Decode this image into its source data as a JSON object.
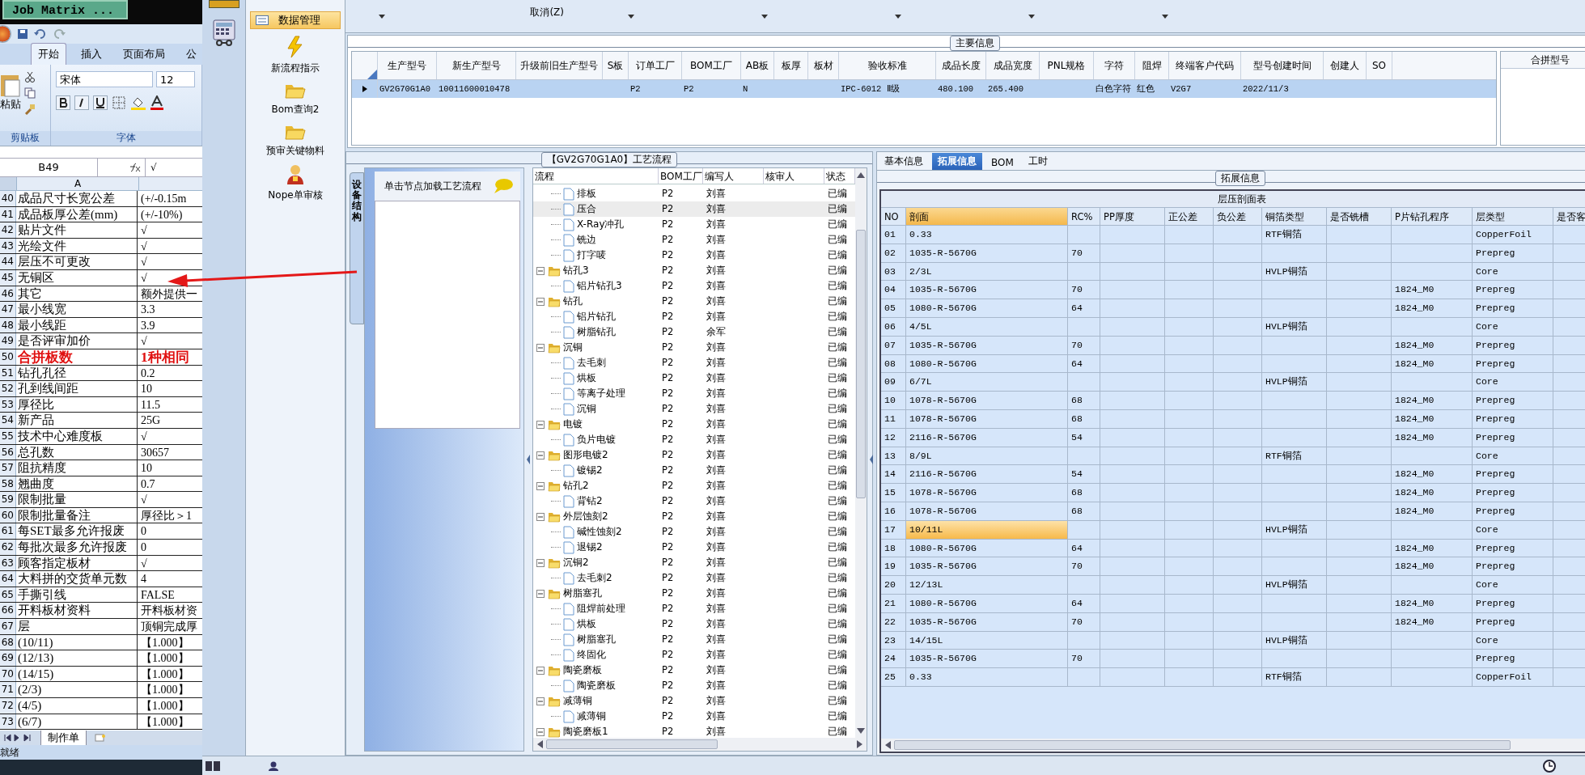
{
  "excel": {
    "title": "Job Matrix ...",
    "ribbon_tabs": [
      {
        "label": "开始",
        "selected": true
      },
      {
        "label": "插入",
        "selected": false
      },
      {
        "label": "页面布局",
        "selected": false
      },
      {
        "label": "公",
        "selected": false
      }
    ],
    "paste_label": "粘贴",
    "clipboard_group": "剪贴板",
    "font_name": "宋体",
    "font_size": "12",
    "font_group": "字体",
    "name_box": "B49",
    "formula": "√",
    "column_header": "A",
    "rows": [
      {
        "num": "40",
        "a": "成品尺寸长宽公差",
        "b": "(+/-0.15m",
        "emphasis": false
      },
      {
        "num": "41",
        "a": "成品板厚公差(mm)",
        "b": "(+/-10%)",
        "emphasis": false
      },
      {
        "num": "42",
        "a": "贴片文件",
        "b": "√",
        "emphasis": false
      },
      {
        "num": "43",
        "a": "光绘文件",
        "b": "√",
        "emphasis": false
      },
      {
        "num": "44",
        "a": "层压不可更改",
        "b": "√",
        "emphasis": false
      },
      {
        "num": "45",
        "a": "无铜区",
        "b": "√",
        "emphasis": false
      },
      {
        "num": "46",
        "a": "其它",
        "b": "额外提供一",
        "emphasis": false
      },
      {
        "num": "47",
        "a": "最小线宽",
        "b": "3.3",
        "emphasis": false
      },
      {
        "num": "48",
        "a": "最小线距",
        "b": "3.9",
        "emphasis": false
      },
      {
        "num": "49",
        "a": "是否评审加价",
        "b": "√",
        "emphasis": false
      },
      {
        "num": "50",
        "a": "合拼板数",
        "b": "1种相同",
        "emphasis": true
      },
      {
        "num": "51",
        "a": "钻孔孔径",
        "b": "0.2",
        "emphasis": false
      },
      {
        "num": "52",
        "a": "孔到线间距",
        "b": "10",
        "emphasis": false
      },
      {
        "num": "53",
        "a": "厚径比",
        "b": "11.5",
        "emphasis": false
      },
      {
        "num": "54",
        "a": "新产品",
        "b": "25G",
        "emphasis": false
      },
      {
        "num": "55",
        "a": "技术中心难度板",
        "b": "√",
        "emphasis": false
      },
      {
        "num": "56",
        "a": "总孔数",
        "b": "30657",
        "emphasis": false
      },
      {
        "num": "57",
        "a": "阻抗精度",
        "b": "10",
        "emphasis": false
      },
      {
        "num": "58",
        "a": "翘曲度",
        "b": "0.7",
        "emphasis": false
      },
      {
        "num": "59",
        "a": "限制批量",
        "b": "√",
        "emphasis": false
      },
      {
        "num": "60",
        "a": "限制批量备注",
        "b": "厚径比＞1",
        "emphasis": false
      },
      {
        "num": "61",
        "a": "每SET最多允许报废",
        "b": "0",
        "emphasis": false
      },
      {
        "num": "62",
        "a": "每批次最多允许报废",
        "b": "0",
        "emphasis": false
      },
      {
        "num": "63",
        "a": "顾客指定板材",
        "b": "√",
        "emphasis": false
      },
      {
        "num": "64",
        "a": "大料拼的交货单元数",
        "b": "4",
        "emphasis": false
      },
      {
        "num": "65",
        "a": "手撕引线",
        "b": "FALSE",
        "emphasis": false
      },
      {
        "num": "66",
        "a": "开料板材资料",
        "b": "开料板材资",
        "emphasis": false
      },
      {
        "num": "67",
        "a": "层",
        "b": "顶铜完成厚",
        "emphasis": false
      },
      {
        "num": "68",
        "a": "(10/11)",
        "b": "【1.000】",
        "emphasis": false
      },
      {
        "num": "69",
        "a": "(12/13)",
        "b": "【1.000】",
        "emphasis": false
      },
      {
        "num": "70",
        "a": "(14/15)",
        "b": "【1.000】",
        "emphasis": false
      },
      {
        "num": "71",
        "a": "(2/3)",
        "b": "【1.000】",
        "emphasis": false
      },
      {
        "num": "72",
        "a": "(4/5)",
        "b": "【1.000】",
        "emphasis": false
      },
      {
        "num": "73",
        "a": "(6/7)",
        "b": "【1.000】",
        "emphasis": false
      }
    ],
    "sheet_tab": "制作单",
    "status": "就绪"
  },
  "nav": {
    "items": [
      {
        "label": "数据管理",
        "selected": true
      }
    ],
    "tools": [
      {
        "kind": "bolt",
        "label": "新流程指示"
      },
      {
        "kind": "folder",
        "label": "Bom查询2"
      },
      {
        "kind": "folder",
        "label": "预审关键物料"
      },
      {
        "kind": "person",
        "label": "Nope单审核"
      }
    ]
  },
  "toolbar": {
    "label": "取消(Z)"
  },
  "main_info": {
    "title": "主要信息",
    "columns": [
      "生产型号",
      "新生产型号",
      "升级前旧生产型号",
      "S板",
      "订单工厂",
      "BOM工厂",
      "AB板",
      "板厚",
      "板材",
      "验收标准",
      "成品长度",
      "成品宽度",
      "PNL规格",
      "字符",
      "阻焊",
      "终端客户代码",
      "型号创建时间",
      "创建人",
      "SO"
    ],
    "rows": [
      {
        "selected": true,
        "cells": [
          "GV2G70G1A0",
          "10011600010478",
          "",
          "",
          "P2",
          "P2",
          "N",
          "",
          "",
          "IPC-6012 Ⅱ级",
          "480.100",
          "265.400",
          "",
          "白色字符",
          "红色",
          "V2G7",
          "2022/11/3",
          "",
          ""
        ]
      }
    ],
    "merge_title": "合拼型号"
  },
  "flow": {
    "title": "【GV2G70G1A0】工艺流程",
    "side_tab": "设备结构",
    "hint": "单击节点加载工艺流程",
    "columns": [
      "流程",
      "BOM工厂",
      "编写人",
      "核审人",
      "状态"
    ],
    "nodes": [
      {
        "children": [
          {
            "label": "排板",
            "bom": "P2",
            "writer": "刘喜",
            "status": "已编",
            "selected": false
          },
          {
            "label": "压合",
            "bom": "P2",
            "writer": "刘喜",
            "status": "已编",
            "selected": true
          },
          {
            "label": "X-Ray冲孔",
            "bom": "P2",
            "writer": "刘喜",
            "status": "已编",
            "selected": false
          },
          {
            "label": "铣边",
            "bom": "P2",
            "writer": "刘喜",
            "status": "已编",
            "selected": false
          },
          {
            "label": "打字唛",
            "bom": "P2",
            "writer": "刘喜",
            "status": "已编",
            "selected": false
          }
        ]
      },
      {
        "label": "钻孔3",
        "bom": "P2",
        "writer": "刘喜",
        "status": "已编",
        "selected": false,
        "expanded": true,
        "children": [
          {
            "label": "铝片钻孔3",
            "bom": "P2",
            "writer": "刘喜",
            "status": "已编",
            "selected": false
          }
        ]
      },
      {
        "label": "钻孔",
        "bom": "P2",
        "writer": "刘喜",
        "status": "已编",
        "selected": false,
        "expanded": true,
        "children": [
          {
            "label": "铝片钻孔",
            "bom": "P2",
            "writer": "刘喜",
            "status": "已编",
            "selected": false
          },
          {
            "label": "树脂钻孔",
            "bom": "P2",
            "writer": "余军",
            "status": "已编",
            "selected": false
          }
        ]
      },
      {
        "label": "沉铜",
        "bom": "P2",
        "writer": "刘喜",
        "status": "已编",
        "selected": false,
        "expanded": true,
        "children": [
          {
            "label": "去毛刺",
            "bom": "P2",
            "writer": "刘喜",
            "status": "已编",
            "selected": false
          },
          {
            "label": "烘板",
            "bom": "P2",
            "writer": "刘喜",
            "status": "已编",
            "selected": false
          },
          {
            "label": "等离子处理",
            "bom": "P2",
            "writer": "刘喜",
            "status": "已编",
            "selected": false
          },
          {
            "label": "沉铜",
            "bom": "P2",
            "writer": "刘喜",
            "status": "已编",
            "selected": false
          }
        ]
      },
      {
        "label": "电镀",
        "bom": "P2",
        "writer": "刘喜",
        "status": "已编",
        "selected": false,
        "expanded": true,
        "children": [
          {
            "label": "负片电镀",
            "bom": "P2",
            "writer": "刘喜",
            "status": "已编",
            "selected": false
          }
        ]
      },
      {
        "label": "图形电镀2",
        "bom": "P2",
        "writer": "刘喜",
        "status": "已编",
        "selected": false,
        "expanded": true,
        "children": [
          {
            "label": "镀锡2",
            "bom": "P2",
            "writer": "刘喜",
            "status": "已编",
            "selected": false
          }
        ]
      },
      {
        "label": "钻孔2",
        "bom": "P2",
        "writer": "刘喜",
        "status": "已编",
        "selected": false,
        "expanded": true,
        "children": [
          {
            "label": "背钻2",
            "bom": "P2",
            "writer": "刘喜",
            "status": "已编",
            "selected": false
          }
        ]
      },
      {
        "label": "外层蚀刻2",
        "bom": "P2",
        "writer": "刘喜",
        "status": "已编",
        "selected": false,
        "expanded": true,
        "children": [
          {
            "label": "碱性蚀刻2",
            "bom": "P2",
            "writer": "刘喜",
            "status": "已编",
            "selected": false
          },
          {
            "label": "退锡2",
            "bom": "P2",
            "writer": "刘喜",
            "status": "已编",
            "selected": false
          }
        ]
      },
      {
        "label": "沉铜2",
        "bom": "P2",
        "writer": "刘喜",
        "status": "已编",
        "selected": false,
        "expanded": true,
        "children": [
          {
            "label": "去毛刺2",
            "bom": "P2",
            "writer": "刘喜",
            "status": "已编",
            "selected": false
          }
        ]
      },
      {
        "label": "树脂塞孔",
        "bom": "P2",
        "writer": "刘喜",
        "status": "已编",
        "selected": false,
        "expanded": true,
        "children": [
          {
            "label": "阻焊前处理",
            "bom": "P2",
            "writer": "刘喜",
            "status": "已编",
            "selected": false
          },
          {
            "label": "烘板",
            "bom": "P2",
            "writer": "刘喜",
            "status": "已编",
            "selected": false
          },
          {
            "label": "树脂塞孔",
            "bom": "P2",
            "writer": "刘喜",
            "status": "已编",
            "selected": false
          },
          {
            "label": "终固化",
            "bom": "P2",
            "writer": "刘喜",
            "status": "已编",
            "selected": false
          }
        ]
      },
      {
        "label": "陶瓷磨板",
        "bom": "P2",
        "writer": "刘喜",
        "status": "已编",
        "selected": false,
        "expanded": true,
        "children": [
          {
            "label": "陶瓷磨板",
            "bom": "P2",
            "writer": "刘喜",
            "status": "已编",
            "selected": false
          }
        ]
      },
      {
        "label": "减薄铜",
        "bom": "P2",
        "writer": "刘喜",
        "status": "已编",
        "selected": false,
        "expanded": true,
        "children": [
          {
            "label": "减薄铜",
            "bom": "P2",
            "writer": "刘喜",
            "status": "已编",
            "selected": false
          }
        ]
      },
      {
        "label": "陶瓷磨板1",
        "bom": "P2",
        "writer": "刘喜",
        "status": "已编",
        "selected": false,
        "expanded": true
      }
    ]
  },
  "detail": {
    "tabs": [
      {
        "label": "基本信息",
        "selected": false
      },
      {
        "label": "拓展信息",
        "selected": true
      },
      {
        "label": "BOM",
        "selected": false
      },
      {
        "label": "工时",
        "selected": false
      }
    ],
    "group_title": "拓展信息",
    "table_title": "层压剖面表",
    "columns": [
      {
        "label": "NO",
        "selected": false
      },
      {
        "label": "剖面",
        "selected": true
      },
      {
        "label": "RC%",
        "selected": false
      },
      {
        "label": "PP厚度",
        "selected": false
      },
      {
        "label": "正公差",
        "selected": false
      },
      {
        "label": "负公差",
        "selected": false
      },
      {
        "label": "铜箔类型",
        "selected": false
      },
      {
        "label": "是否铣槽",
        "selected": false
      },
      {
        "label": "P片钻孔程序",
        "selected": false
      },
      {
        "label": "层类型",
        "selected": false
      },
      {
        "label": "是否客",
        "selected": false
      }
    ],
    "rows": [
      {
        "selected": false,
        "cells": [
          "01",
          "0.33",
          "",
          "",
          "",
          "",
          "RTF铜箔",
          "",
          "",
          "CopperFoil",
          ""
        ]
      },
      {
        "selected": false,
        "cells": [
          "02",
          "1035-R-5670G",
          "70",
          "",
          "",
          "",
          "",
          "",
          "",
          "Prepreg",
          ""
        ]
      },
      {
        "selected": false,
        "cells": [
          "03",
          "2/3L",
          "",
          "",
          "",
          "",
          "HVLP铜箔",
          "",
          "",
          "Core",
          ""
        ]
      },
      {
        "selected": false,
        "cells": [
          "04",
          "1035-R-5670G",
          "70",
          "",
          "",
          "",
          "",
          "",
          "1824_M0",
          "Prepreg",
          ""
        ]
      },
      {
        "selected": false,
        "cells": [
          "05",
          "1080-R-5670G",
          "64",
          "",
          "",
          "",
          "",
          "",
          "1824_M0",
          "Prepreg",
          ""
        ]
      },
      {
        "selected": false,
        "cells": [
          "06",
          "4/5L",
          "",
          "",
          "",
          "",
          "HVLP铜箔",
          "",
          "",
          "Core",
          ""
        ]
      },
      {
        "selected": false,
        "cells": [
          "07",
          "1035-R-5670G",
          "70",
          "",
          "",
          "",
          "",
          "",
          "1824_M0",
          "Prepreg",
          ""
        ]
      },
      {
        "selected": false,
        "cells": [
          "08",
          "1080-R-5670G",
          "64",
          "",
          "",
          "",
          "",
          "",
          "1824_M0",
          "Prepreg",
          ""
        ]
      },
      {
        "selected": false,
        "cells": [
          "09",
          "6/7L",
          "",
          "",
          "",
          "",
          "HVLP铜箔",
          "",
          "",
          "Core",
          ""
        ]
      },
      {
        "selected": false,
        "cells": [
          "10",
          "1078-R-5670G",
          "68",
          "",
          "",
          "",
          "",
          "",
          "1824_M0",
          "Prepreg",
          ""
        ]
      },
      {
        "selected": false,
        "cells": [
          "11",
          "1078-R-5670G",
          "68",
          "",
          "",
          "",
          "",
          "",
          "1824_M0",
          "Prepreg",
          ""
        ]
      },
      {
        "selected": false,
        "cells": [
          "12",
          "2116-R-5670G",
          "54",
          "",
          "",
          "",
          "",
          "",
          "1824_M0",
          "Prepreg",
          ""
        ]
      },
      {
        "selected": false,
        "cells": [
          "13",
          "8/9L",
          "",
          "",
          "",
          "",
          "RTF铜箔",
          "",
          "",
          "Core",
          ""
        ]
      },
      {
        "selected": false,
        "cells": [
          "14",
          "2116-R-5670G",
          "54",
          "",
          "",
          "",
          "",
          "",
          "1824_M0",
          "Prepreg",
          ""
        ]
      },
      {
        "selected": false,
        "cells": [
          "15",
          "1078-R-5670G",
          "68",
          "",
          "",
          "",
          "",
          "",
          "1824_M0",
          "Prepreg",
          ""
        ]
      },
      {
        "selected": false,
        "cells": [
          "16",
          "1078-R-5670G",
          "68",
          "",
          "",
          "",
          "",
          "",
          "1824_M0",
          "Prepreg",
          ""
        ]
      },
      {
        "selected": true,
        "cells": [
          "17",
          "10/11L",
          "",
          "",
          "",
          "",
          "HVLP铜箔",
          "",
          "",
          "Core",
          ""
        ]
      },
      {
        "selected": false,
        "cells": [
          "18",
          "1080-R-5670G",
          "64",
          "",
          "",
          "",
          "",
          "",
          "1824_M0",
          "Prepreg",
          ""
        ]
      },
      {
        "selected": false,
        "cells": [
          "19",
          "1035-R-5670G",
          "70",
          "",
          "",
          "",
          "",
          "",
          "1824_M0",
          "Prepreg",
          ""
        ]
      },
      {
        "selected": false,
        "cells": [
          "20",
          "12/13L",
          "",
          "",
          "",
          "",
          "HVLP铜箔",
          "",
          "",
          "Core",
          ""
        ]
      },
      {
        "selected": false,
        "cells": [
          "21",
          "1080-R-5670G",
          "64",
          "",
          "",
          "",
          "",
          "",
          "1824_M0",
          "Prepreg",
          ""
        ]
      },
      {
        "selected": false,
        "cells": [
          "22",
          "1035-R-5670G",
          "70",
          "",
          "",
          "",
          "",
          "",
          "1824_M0",
          "Prepreg",
          ""
        ]
      },
      {
        "selected": false,
        "cells": [
          "23",
          "14/15L",
          "",
          "",
          "",
          "",
          "HVLP铜箔",
          "",
          "",
          "Core",
          ""
        ]
      },
      {
        "selected": false,
        "cells": [
          "24",
          "1035-R-5670G",
          "70",
          "",
          "",
          "",
          "",
          "",
          "",
          "Prepreg",
          ""
        ]
      },
      {
        "selected": false,
        "cells": [
          "25",
          "0.33",
          "",
          "",
          "",
          "",
          "RTF铜箔",
          "",
          "",
          "CopperFoil",
          ""
        ]
      }
    ]
  }
}
